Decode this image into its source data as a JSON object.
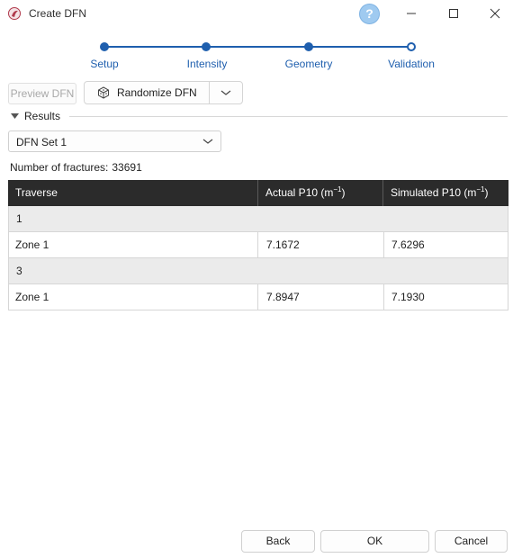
{
  "window": {
    "title": "Create DFN",
    "help_label": "?"
  },
  "stepper": {
    "steps": [
      {
        "label": "Setup",
        "state": "completed"
      },
      {
        "label": "Intensity",
        "state": "completed"
      },
      {
        "label": "Geometry",
        "state": "completed"
      },
      {
        "label": "Validation",
        "state": "current"
      }
    ]
  },
  "toolbar": {
    "preview_label": "Preview DFN",
    "randomize_label": "Randomize DFN"
  },
  "results": {
    "label": "Results",
    "selected_set": "DFN Set 1",
    "fractures_label": "Number of fractures:",
    "fractures_value": "33691"
  },
  "table": {
    "headers": {
      "traverse": "Traverse",
      "actual_prefix": "Actual P10 (m",
      "actual_sup": "−1",
      "actual_suffix": ")",
      "simulated_prefix": "Simulated P10 (m",
      "simulated_sup": "−1",
      "simulated_suffix": ")"
    },
    "groups": [
      {
        "name": "1",
        "rows": [
          {
            "traverse": "Zone 1",
            "actual": "7.1672",
            "simulated": "7.6296"
          }
        ]
      },
      {
        "name": "3",
        "rows": [
          {
            "traverse": "Zone 1",
            "actual": "7.8947",
            "simulated": "7.1930"
          }
        ]
      }
    ]
  },
  "footer": {
    "back_label": "Back",
    "ok_label": "OK",
    "cancel_label": "Cancel"
  },
  "colors": {
    "accent": "#1f5fae",
    "header_bg": "#2b2b2b",
    "group_bg": "#ebebeb"
  }
}
